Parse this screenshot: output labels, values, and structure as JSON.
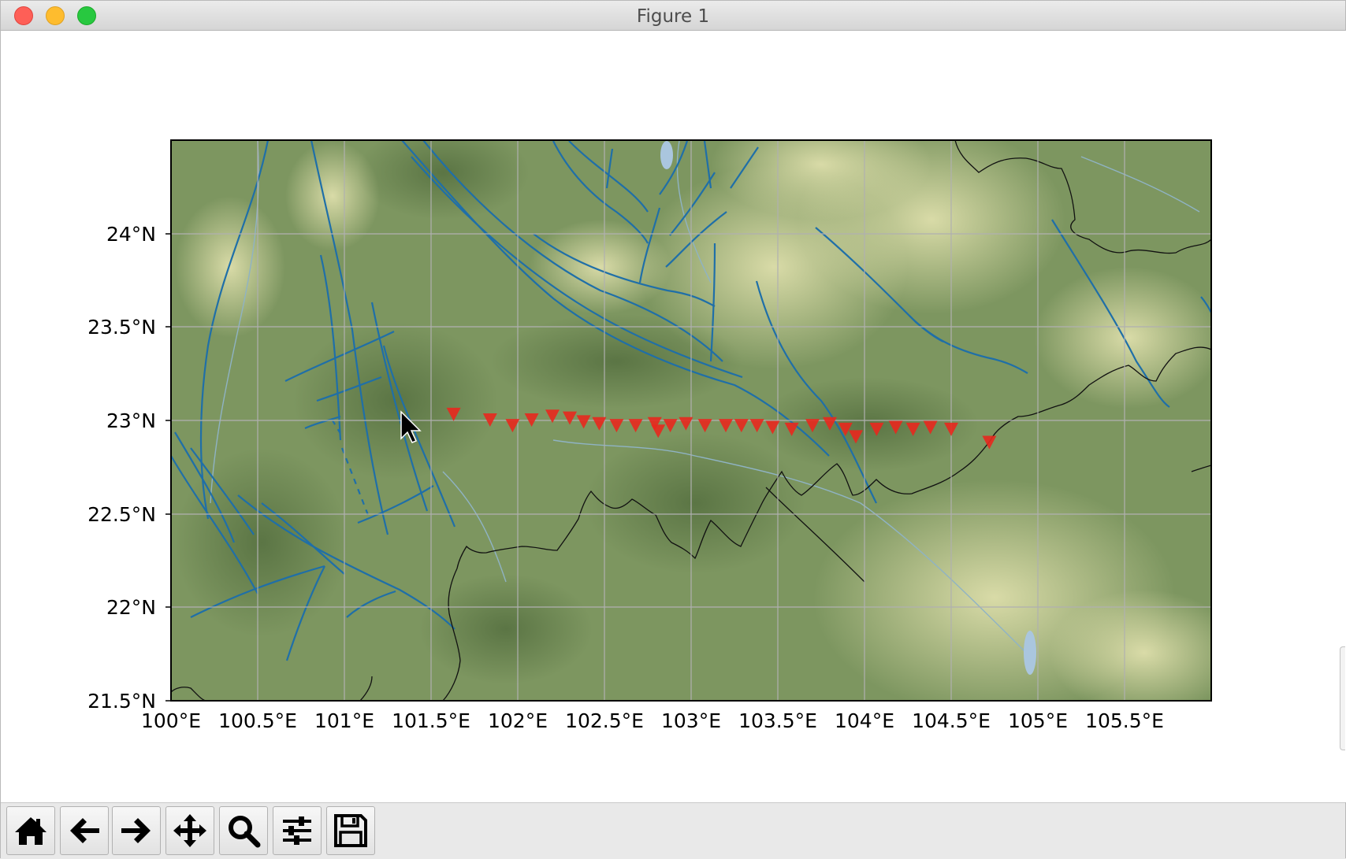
{
  "window": {
    "title": "Figure 1"
  },
  "map": {
    "x_ticks": [
      "100°E",
      "100.5°E",
      "101°E",
      "101.5°E",
      "102°E",
      "102.5°E",
      "103°E",
      "103.5°E",
      "104°E",
      "104.5°E",
      "105°E",
      "105.5°E"
    ],
    "y_ticks": [
      "24°N",
      "23.5°N",
      "23°N",
      "22.5°N",
      "22°N",
      "21.5°N"
    ],
    "extent": {
      "lon": [
        100.0,
        106.0
      ],
      "lat": [
        21.5,
        24.5
      ]
    },
    "grid": true,
    "station_color": "#e8281e",
    "fault_color": "#1f6fa8",
    "border_color": "#000000",
    "stations": [
      [
        101.63,
        23.03
      ],
      [
        101.84,
        23.0
      ],
      [
        101.97,
        22.97
      ],
      [
        102.08,
        23.0
      ],
      [
        102.2,
        23.02
      ],
      [
        102.3,
        23.01
      ],
      [
        102.38,
        22.99
      ],
      [
        102.47,
        22.98
      ],
      [
        102.57,
        22.97
      ],
      [
        102.68,
        22.97
      ],
      [
        102.79,
        22.98
      ],
      [
        102.81,
        22.94
      ],
      [
        102.88,
        22.97
      ],
      [
        102.97,
        22.98
      ],
      [
        103.08,
        22.97
      ],
      [
        103.2,
        22.97
      ],
      [
        103.29,
        22.97
      ],
      [
        103.38,
        22.97
      ],
      [
        103.47,
        22.96
      ],
      [
        103.58,
        22.95
      ],
      [
        103.7,
        22.97
      ],
      [
        103.8,
        22.98
      ],
      [
        103.89,
        22.95
      ],
      [
        103.95,
        22.91
      ],
      [
        104.07,
        22.95
      ],
      [
        104.18,
        22.96
      ],
      [
        104.28,
        22.95
      ],
      [
        104.38,
        22.96
      ],
      [
        104.5,
        22.95
      ],
      [
        104.72,
        22.88
      ]
    ]
  },
  "toolbar": {
    "home": "home-icon",
    "back": "arrow-left-icon",
    "forward": "arrow-right-icon",
    "pan": "move-icon",
    "zoom": "magnifier-icon",
    "configure": "sliders-icon",
    "save": "floppy-disk-icon"
  }
}
